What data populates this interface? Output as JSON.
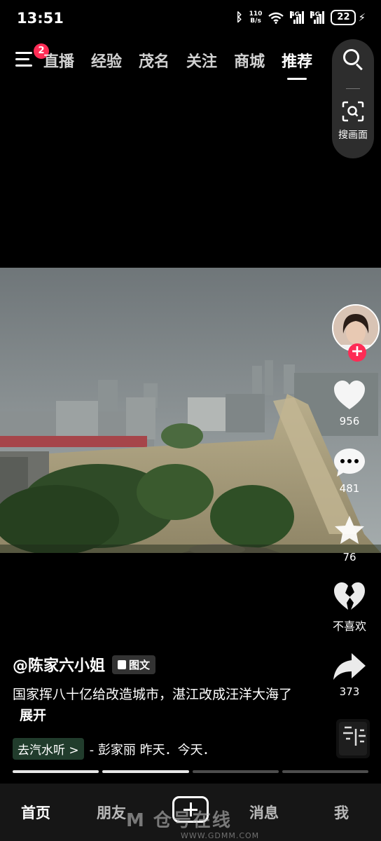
{
  "status": {
    "time": "13:51",
    "net_speed_value": "110",
    "net_speed_unit": "B/s",
    "signal1_label": "4G",
    "signal2_label": "4G",
    "battery": "22"
  },
  "top_nav": {
    "menu_badge": "2",
    "tabs": [
      "直播",
      "经验",
      "茂名",
      "关注",
      "商城",
      "推荐"
    ],
    "active_tab": "推荐",
    "scan_label": "搜画面"
  },
  "rail": {
    "likes": "956",
    "comments": "481",
    "favorites": "76",
    "dislike_label": "不喜欢",
    "shares": "373"
  },
  "caption": {
    "author": "@陈家六小姐",
    "type_tag": "图文",
    "description": "国家挥八十亿给改造城市，湛江改成汪洋大海了",
    "expand_label": "展开",
    "song_chip": "去汽水听 >",
    "song_text": "- 彭家丽    昨天．今天．"
  },
  "progress": {
    "segments": 4,
    "completed": 2
  },
  "bottom_nav": {
    "home": "首页",
    "friends": "朋友",
    "messages": "消息",
    "me": "我"
  },
  "watermark": {
    "main": "M 仓号在线",
    "sub": "WWW.GDMM.COM"
  },
  "colors": {
    "accent": "#fe2c55",
    "background": "#000000",
    "bottom_nav_bg": "#161616"
  }
}
